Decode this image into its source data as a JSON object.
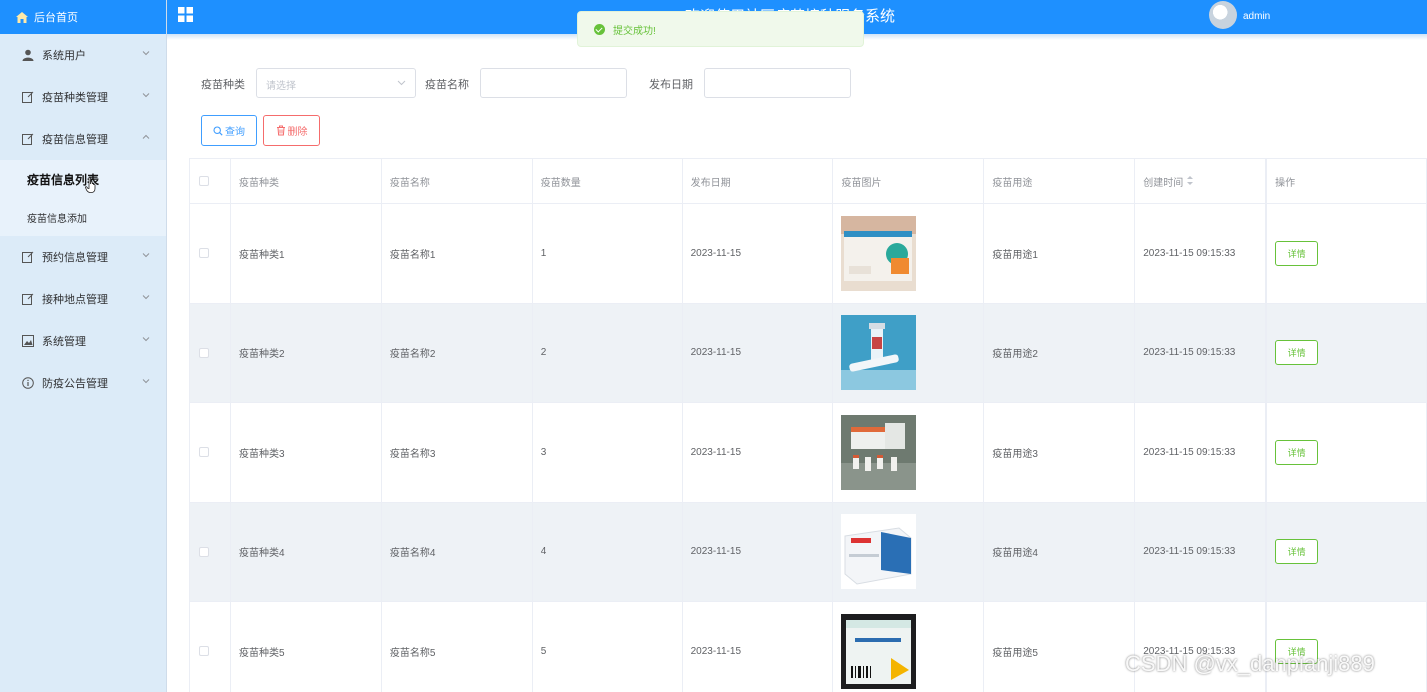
{
  "sidebar": {
    "home_label": "后台首页",
    "items": [
      {
        "label": "系统用户",
        "expanded": false
      },
      {
        "label": "疫苗种类管理",
        "expanded": false
      },
      {
        "label": "疫苗信息管理",
        "expanded": true
      },
      {
        "label": "预约信息管理",
        "expanded": false
      },
      {
        "label": "接种地点管理",
        "expanded": false
      },
      {
        "label": "系统管理",
        "expanded": false
      },
      {
        "label": "防疫公告管理",
        "expanded": false
      }
    ],
    "subitems": [
      {
        "label": "疫苗信息列表",
        "active": true
      },
      {
        "label": "疫苗信息添加",
        "active": false
      }
    ]
  },
  "header": {
    "title": "欢迎使用社区疫苗接种服务系统",
    "user": "admin"
  },
  "toast": {
    "message": "提交成功!"
  },
  "search": {
    "type_label": "疫苗种类",
    "type_placeholder": "请选择",
    "name_label": "疫苗名称",
    "name_value": "",
    "date_label": "发布日期",
    "date_value": ""
  },
  "buttons": {
    "query": "查询",
    "delete": "删除"
  },
  "table": {
    "columns": [
      "疫苗种类",
      "疫苗名称",
      "疫苗数量",
      "发布日期",
      "疫苗图片",
      "疫苗用途",
      "创建时间",
      "操作"
    ],
    "rows": [
      {
        "type": "疫苗种类1",
        "name": "疫苗名称1",
        "qty": "1",
        "date": "2023-11-15",
        "use": "疫苗用途1",
        "created": "2023-11-15 09:15:33",
        "action": "详情"
      },
      {
        "type": "疫苗种类2",
        "name": "疫苗名称2",
        "qty": "2",
        "date": "2023-11-15",
        "use": "疫苗用途2",
        "created": "2023-11-15 09:15:33",
        "action": "详情"
      },
      {
        "type": "疫苗种类3",
        "name": "疫苗名称3",
        "qty": "3",
        "date": "2023-11-15",
        "use": "疫苗用途3",
        "created": "2023-11-15 09:15:33",
        "action": "详情"
      },
      {
        "type": "疫苗种类4",
        "name": "疫苗名称4",
        "qty": "4",
        "date": "2023-11-15",
        "use": "疫苗用途4",
        "created": "2023-11-15 09:15:33",
        "action": "详情"
      },
      {
        "type": "疫苗种类5",
        "name": "疫苗名称5",
        "qty": "5",
        "date": "2023-11-15",
        "use": "疫苗用途5",
        "created": "2023-11-15 09:15:33",
        "action": "详情"
      }
    ]
  },
  "watermark": "CSDN @vx_danpianji889",
  "colors": {
    "primary": "#1e90ff",
    "success": "#67c23a",
    "danger": "#f56c6c",
    "sidebar": "#dcebf8"
  }
}
